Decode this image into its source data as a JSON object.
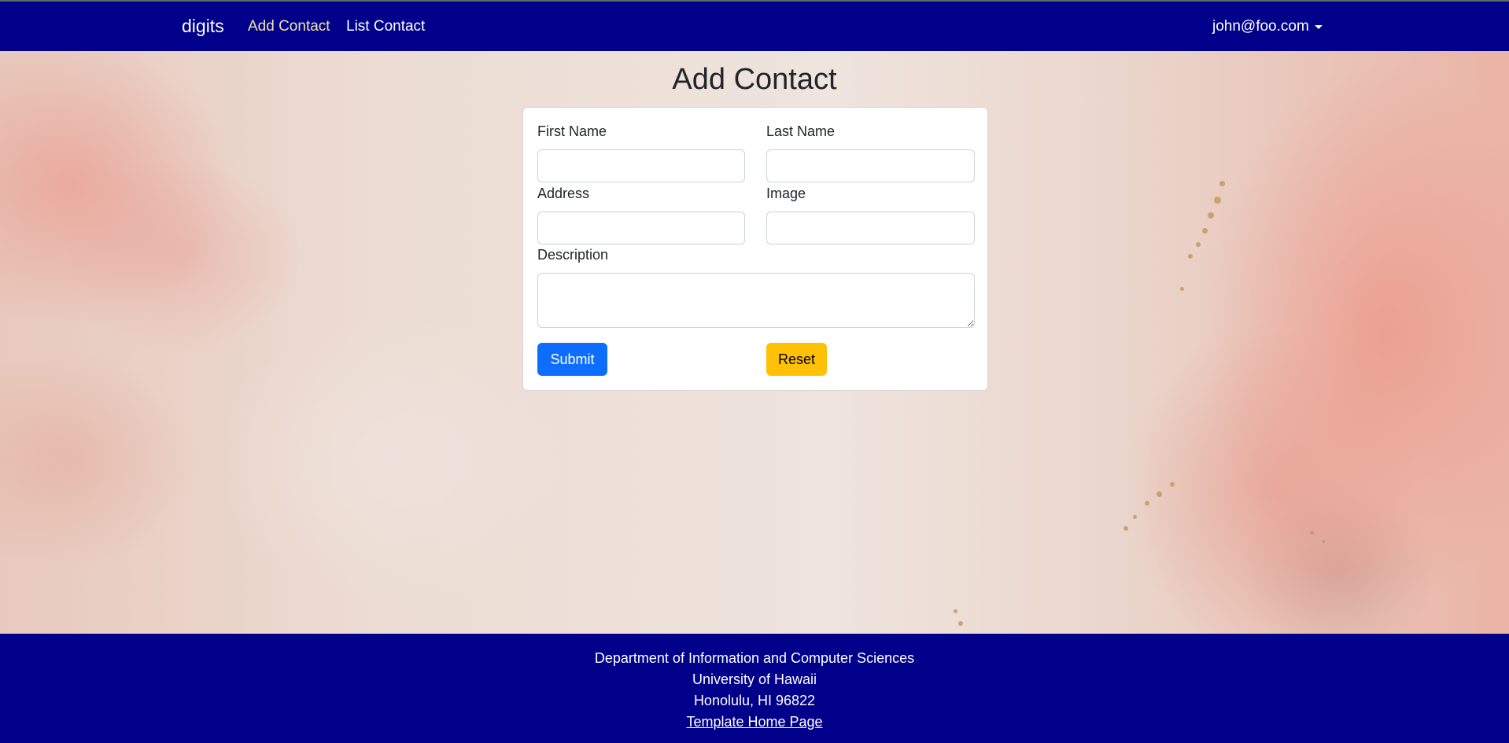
{
  "navbar": {
    "brand": "digits",
    "links": [
      {
        "label": "Add Contact",
        "active": true
      },
      {
        "label": "List Contact",
        "active": false
      }
    ],
    "user": "john@foo.com"
  },
  "page": {
    "title": "Add Contact"
  },
  "form": {
    "fields": {
      "first_name": {
        "label": "First Name",
        "value": ""
      },
      "last_name": {
        "label": "Last Name",
        "value": ""
      },
      "address": {
        "label": "Address",
        "value": ""
      },
      "image": {
        "label": "Image",
        "value": ""
      },
      "description": {
        "label": "Description",
        "value": ""
      }
    },
    "submit_label": "Submit",
    "reset_label": "Reset"
  },
  "footer": {
    "lines": [
      "Department of Information and Computer Sciences",
      "University of Hawaii",
      "Honolulu, HI 96822"
    ],
    "link_label": "Template Home Page"
  },
  "colors": {
    "navbar_bg": "#00008b",
    "active_link": "#f2e3a8",
    "submit_button": "#0d6efd",
    "reset_button": "#ffc107"
  }
}
